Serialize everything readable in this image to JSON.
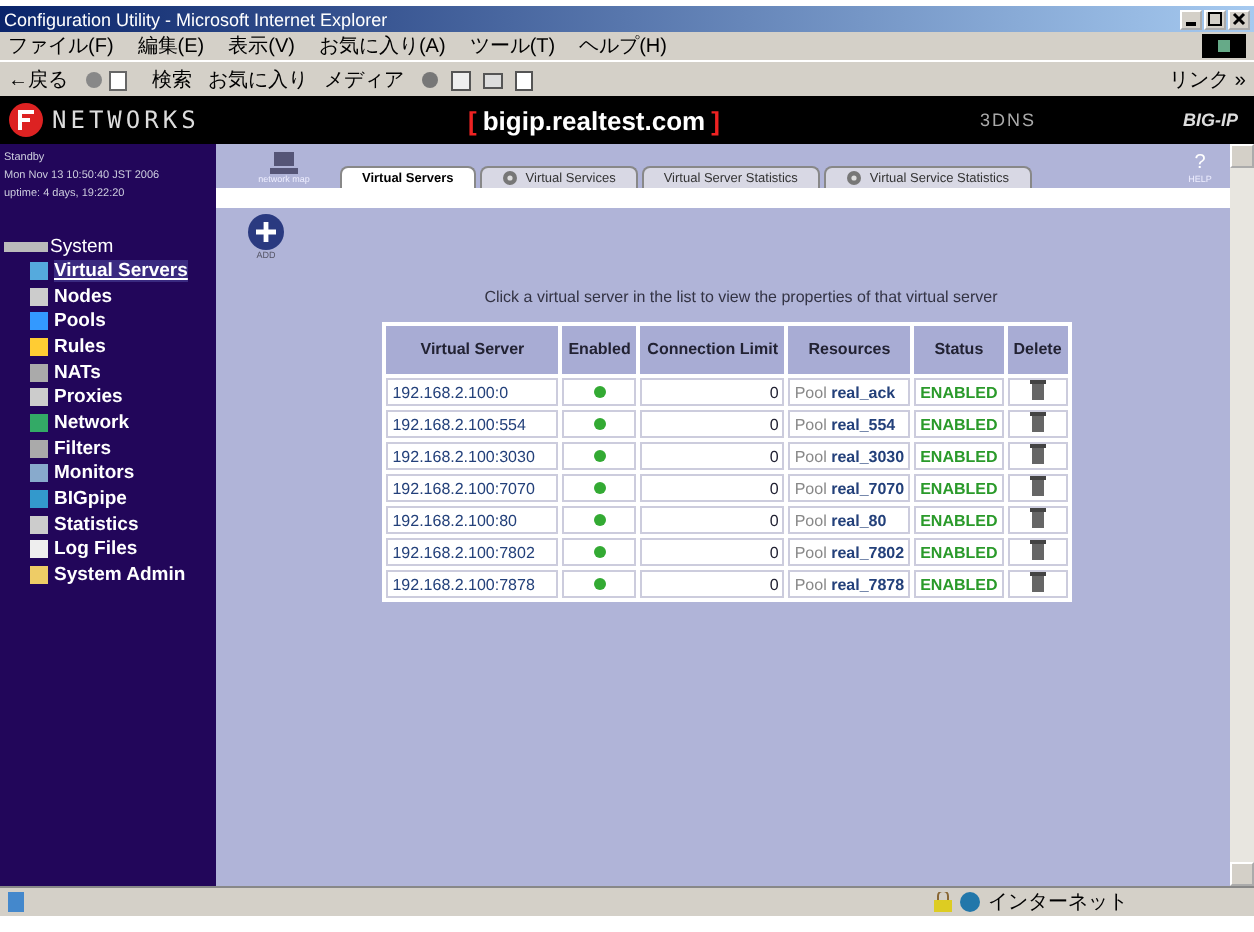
{
  "window": {
    "title": "Configuration Utility - Microsoft Internet Explorer"
  },
  "menu": [
    "ファイル(F)",
    "編集(E)",
    "表示(V)",
    "お気に入り(A)",
    "ツール(T)",
    "ヘルプ(H)"
  ],
  "toolbar": {
    "back": "←戻る",
    "search": "検索",
    "favorites": "お気に入り",
    "media": "メディア",
    "links": "リンク »"
  },
  "banner": {
    "bracket_open": "[",
    "host": "bigip.realtest.com",
    "bracket_close": "]",
    "left_logo": "NETWORKS",
    "right_1": "3DNS",
    "right_2": "BIG-IP"
  },
  "sidebar": {
    "info": [
      "Standby",
      "Mon Nov 13 10:50:40 JST 2006",
      "uptime: 4 days, 19:22:20"
    ],
    "tree": [
      {
        "label": "System",
        "selected": false,
        "children": [
          {
            "label": "Virtual Servers",
            "selected": true
          },
          {
            "label": "Nodes",
            "selected": false
          },
          {
            "label": "Pools",
            "selected": false
          },
          {
            "label": "Rules",
            "selected": false
          },
          {
            "label": "NATs",
            "selected": false
          },
          {
            "label": "Proxies",
            "selected": false
          },
          {
            "label": "Network",
            "selected": false
          },
          {
            "label": "Filters",
            "selected": false
          },
          {
            "label": "Monitors",
            "selected": false
          },
          {
            "label": "BIGpipe",
            "selected": false
          },
          {
            "label": "Statistics",
            "selected": false
          },
          {
            "label": "Log Files",
            "selected": false
          },
          {
            "label": "System Admin",
            "selected": false
          }
        ]
      }
    ]
  },
  "tabs": [
    {
      "label": "Virtual Servers",
      "selected": true,
      "icon": false
    },
    {
      "label": "Virtual Services",
      "selected": false,
      "icon": true
    },
    {
      "label": "Virtual Server Statistics",
      "selected": false,
      "icon": false
    },
    {
      "label": "Virtual Service Statistics",
      "selected": false,
      "icon": true
    }
  ],
  "add_button": "ADD",
  "help_icon": "?",
  "help_label": "HELP",
  "network_map_label": "network map",
  "instruction": "Click a virtual server in the list to view the properties of that virtual server",
  "table": {
    "columns": [
      "Virtual Server",
      "Enabled",
      "Connection Limit",
      "Resources",
      "Status",
      "Delete"
    ],
    "rows": [
      {
        "server": "192.168.2.100:0",
        "enabled": true,
        "limit": "0",
        "pool_prefix": "Pool",
        "pool": "real_ack",
        "status": "ENABLED"
      },
      {
        "server": "192.168.2.100:554",
        "enabled": true,
        "limit": "0",
        "pool_prefix": "Pool",
        "pool": "real_554",
        "status": "ENABLED"
      },
      {
        "server": "192.168.2.100:3030",
        "enabled": true,
        "limit": "0",
        "pool_prefix": "Pool",
        "pool": "real_3030",
        "status": "ENABLED"
      },
      {
        "server": "192.168.2.100:7070",
        "enabled": true,
        "limit": "0",
        "pool_prefix": "Pool",
        "pool": "real_7070",
        "status": "ENABLED"
      },
      {
        "server": "192.168.2.100:80",
        "enabled": true,
        "limit": "0",
        "pool_prefix": "Pool",
        "pool": "real_80",
        "status": "ENABLED"
      },
      {
        "server": "192.168.2.100:7802",
        "enabled": true,
        "limit": "0",
        "pool_prefix": "Pool",
        "pool": "real_7802",
        "status": "ENABLED"
      },
      {
        "server": "192.168.2.100:7878",
        "enabled": true,
        "limit": "0",
        "pool_prefix": "Pool",
        "pool": "real_7878",
        "status": "ENABLED"
      }
    ]
  },
  "status_bar": {
    "zone": "インターネット"
  }
}
